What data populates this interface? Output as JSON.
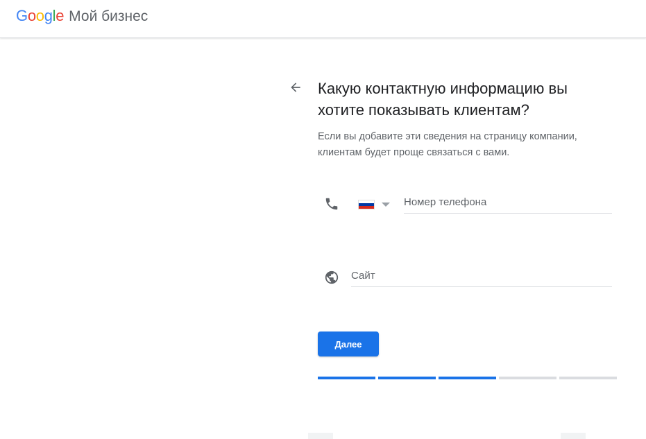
{
  "header": {
    "logo_letters": [
      "G",
      "o",
      "o",
      "g",
      "l",
      "e"
    ],
    "product_name": "Мой бизнес"
  },
  "main": {
    "title_line1": "Какую контактную информацию вы",
    "title_line2": "хотите показывать клиентам?",
    "subtitle_line1": "Если вы добавите эти сведения на страницу компании,",
    "subtitle_line2": "клиентам будет проще связаться с вами.",
    "phone": {
      "icon": "phone-icon",
      "country_flag": "russia-flag",
      "placeholder": "Номер телефона",
      "value": ""
    },
    "website": {
      "icon": "globe-icon",
      "placeholder": "Сайт",
      "value": ""
    },
    "next_button_label": "Далее",
    "progress": {
      "total_steps": 5,
      "completed_steps": 3
    }
  },
  "colors": {
    "accent": "#1a73e8",
    "progress_inactive": "#dadce0",
    "text_secondary": "#5f6368",
    "icon": "#5f6368"
  }
}
